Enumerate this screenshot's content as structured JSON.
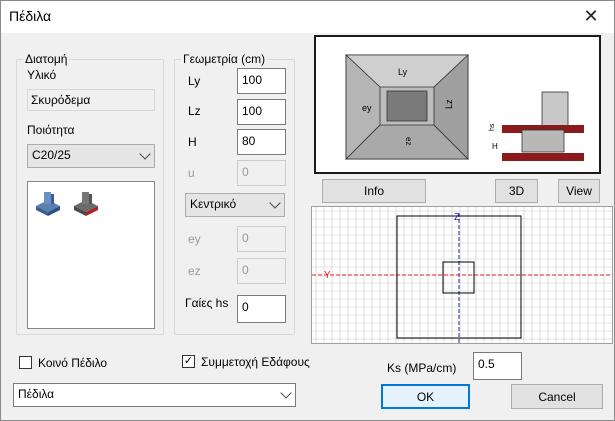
{
  "window": {
    "title": "Πέδιλα",
    "close_glyph": "✕"
  },
  "section": {
    "legend": "Διατομή",
    "material_label": "Υλικό",
    "material_value": "Σκυρόδεμα",
    "quality_label": "Ποιότητα",
    "quality_value": "C20/25"
  },
  "geometry": {
    "legend": "Γεωμετρία (cm)",
    "ly_label": "Ly",
    "ly_value": "100",
    "lz_label": "Lz",
    "lz_value": "100",
    "h_label": "H",
    "h_value": "80",
    "u_label": "u",
    "u_value": "0",
    "position_value": "Κεντρικό",
    "ey_label": "ey",
    "ey_value": "0",
    "ez_label": "ez",
    "ez_value": "0",
    "hs_label": "Γαίες hs",
    "hs_value": "0"
  },
  "preview_labels": {
    "ly": "Ly",
    "lz": "Lz",
    "ey": "ey",
    "ez": "ez",
    "h": "H",
    "hs": "hs"
  },
  "buttons": {
    "info": "Info",
    "view3d": "3D",
    "view": "View",
    "ok": "OK",
    "cancel": "Cancel"
  },
  "plan": {
    "z_axis": "Z",
    "y_axis": "Y"
  },
  "options": {
    "common_footing_label": "Κοινό Πέδιλο",
    "common_footing_checked": false,
    "soil_participation_label": "Συμμετοχή Εδάφους",
    "soil_participation_checked": true
  },
  "ks": {
    "label": "Ks (MPa/cm)",
    "value": "0.5"
  },
  "bottom_combo": {
    "value": "Πέδιλα"
  },
  "colors": {
    "accent": "#0078d7",
    "plan_axis_z": "#2233aa",
    "plan_axis_y": "#dd2222",
    "footing_brick": "#8b1a1a"
  }
}
